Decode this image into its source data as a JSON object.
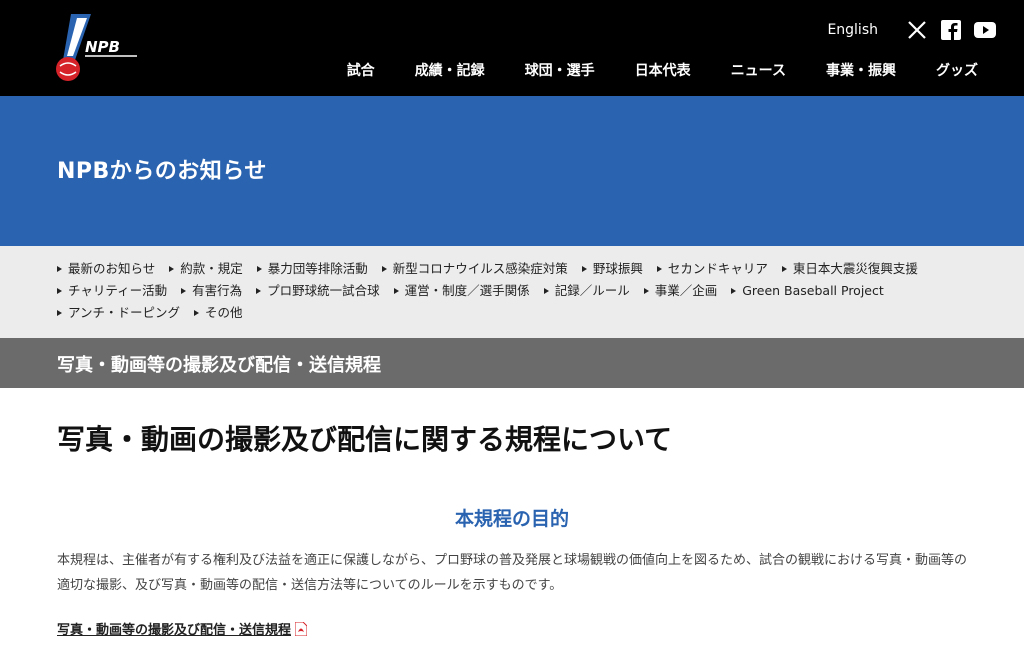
{
  "header": {
    "logo_text": "NPB",
    "english_label": "English",
    "nav": [
      "試合",
      "成績・記録",
      "球団・選手",
      "日本代表",
      "ニュース",
      "事業・振興",
      "グッズ"
    ]
  },
  "banner": {
    "title": "NPBからのお知らせ"
  },
  "subnav": {
    "items": [
      "最新のお知らせ",
      "約款・規定",
      "暴力団等排除活動",
      "新型コロナウイルス感染症対策",
      "野球振興",
      "セカンドキャリア",
      "東日本大震災復興支援",
      "チャリティー活動",
      "有害行為",
      "プロ野球統一試合球",
      "運営・制度／選手関係",
      "記録／ルール",
      "事業／企画",
      "Green Baseball Project",
      "アンチ・ドーピング",
      "その他"
    ]
  },
  "section": {
    "title": "写真・動画等の撮影及び配信・送信規程"
  },
  "content": {
    "title": "写真・動画の撮影及び配信に関する規程について",
    "purpose_heading": "本規程の目的",
    "body": "本規程は、主催者が有する権利及び法益を適正に保護しながら、プロ野球の普及発展と球場観戦の価値向上を図るため、試合の観戦における写真・動画等の適切な撮影、及び写真・動画等の配信・送信方法等についてのルールを示すものです。",
    "doc_link": "写真・動画等の撮影及び配信・送信規程"
  },
  "colors": {
    "header_bg": "#000000",
    "banner_blue": "#2a63b0",
    "section_gray": "#6b6b6b",
    "subnav_bg": "#ececec",
    "pdf_red": "#d6232a"
  },
  "icons": [
    "npb-logo",
    "x-icon",
    "facebook-icon",
    "youtube-icon",
    "pdf-icon"
  ]
}
